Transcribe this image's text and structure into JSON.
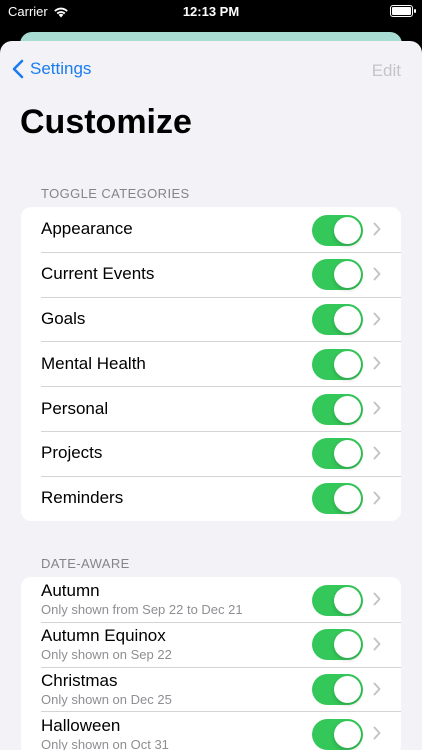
{
  "status_bar": {
    "carrier": "Carrier",
    "time": "12:13 PM"
  },
  "nav": {
    "back_label": "Settings",
    "edit_label": "Edit"
  },
  "title": "Customize",
  "sections": {
    "toggle_categories": {
      "header": "TOGGLE CATEGORIES",
      "items": [
        {
          "label": "Appearance",
          "enabled": true
        },
        {
          "label": "Current Events",
          "enabled": true
        },
        {
          "label": "Goals",
          "enabled": true
        },
        {
          "label": "Mental Health",
          "enabled": true
        },
        {
          "label": "Personal",
          "enabled": true
        },
        {
          "label": "Projects",
          "enabled": true
        },
        {
          "label": "Reminders",
          "enabled": true
        }
      ]
    },
    "date_aware": {
      "header": "DATE-AWARE",
      "items": [
        {
          "label": "Autumn",
          "subtitle": "Only shown from Sep 22 to Dec 21",
          "enabled": true
        },
        {
          "label": "Autumn Equinox",
          "subtitle": "Only shown on Sep 22",
          "enabled": true
        },
        {
          "label": "Christmas",
          "subtitle": "Only shown on Dec 25",
          "enabled": true
        },
        {
          "label": "Halloween",
          "subtitle": "Only shown on Oct 31",
          "enabled": true
        }
      ]
    }
  },
  "colors": {
    "accent": "#1a7cf0",
    "toggle_on": "#34c759",
    "background": "#f2f2f7"
  }
}
